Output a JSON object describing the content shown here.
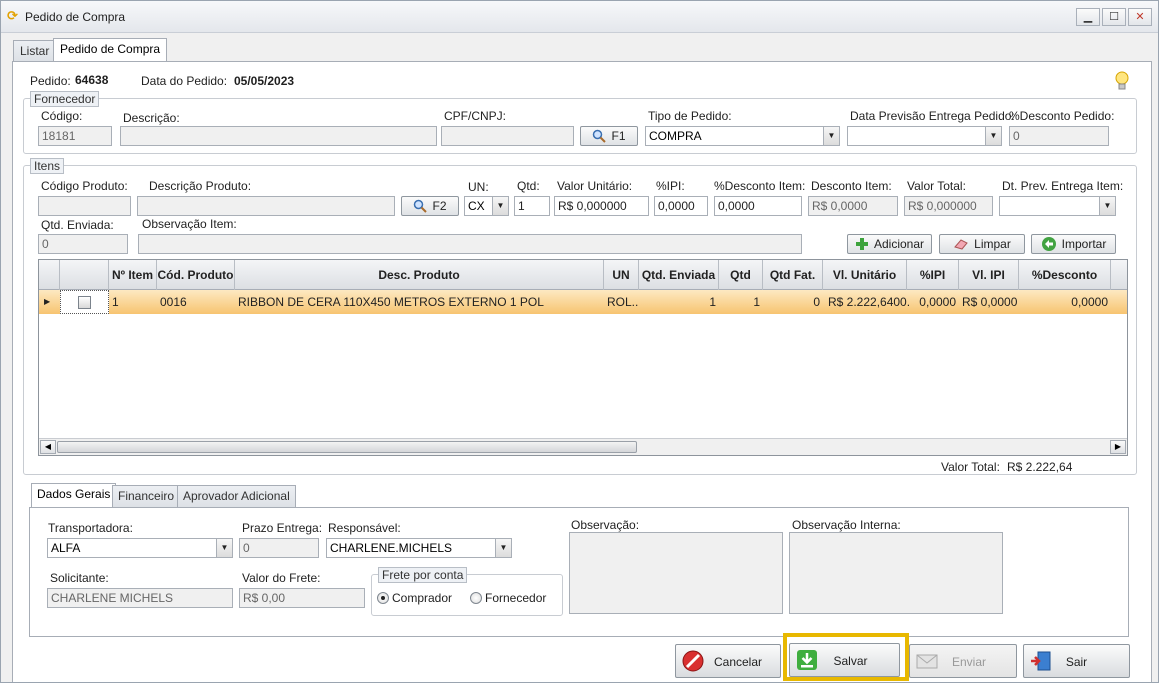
{
  "window": {
    "title": "Pedido de Compra",
    "min": "▁",
    "max": "☐",
    "close": "✕"
  },
  "tabs": [
    "Listar",
    "Pedido de Compra"
  ],
  "header": {
    "pedido_label": "Pedido:",
    "pedido_value": "64638",
    "data_label": "Data do Pedido:",
    "data_value": "05/05/2023"
  },
  "fornecedor": {
    "legend": "Fornecedor",
    "codigo_label": "Código:",
    "codigo_value": "18181",
    "descricao_label": "Descrição:",
    "cpf_label": "CPF/CNPJ:",
    "f1_label": "F1",
    "tipo_label": "Tipo de Pedido:",
    "tipo_value": "COMPRA",
    "data_prev_label": "Data Previsão Entrega Pedido:",
    "data_prev_value": "",
    "desconto_label": "%Desconto Pedido:",
    "desconto_value": "0"
  },
  "itens": {
    "legend": "Itens",
    "cod_prod_label": "Código Produto:",
    "desc_prod_label": "Descrição Produto:",
    "f2_label": "F2",
    "un_label": "UN:",
    "un_value": "CX",
    "qtd_label": "Qtd:",
    "qtd_value": "1",
    "valor_unit_label": "Valor Unitário:",
    "valor_unit_value": "R$ 0,000000",
    "ipi_label": "%IPI:",
    "ipi_value": "0,0000",
    "pdesc_label": "%Desconto Item:",
    "pdesc_value": "0,0000",
    "desc_item_label": "Desconto Item:",
    "desc_item_value": "R$ 0,0000",
    "valor_total_label": "Valor Total:",
    "valor_total_value": "R$ 0,000000",
    "dt_prev_label": "Dt. Prev. Entrega Item:",
    "qtd_env_label": "Qtd. Enviada:",
    "qtd_env_value": "0",
    "obs_label": "Observação Item:",
    "adicionar": "Adicionar",
    "limpar": "Limpar",
    "importar": "Importar"
  },
  "grid": {
    "columns": [
      "Nº Item",
      "Cód. Produto",
      "Desc. Produto",
      "UN",
      "Qtd. Enviada",
      "Qtd",
      "Qtd Fat.",
      "Vl. Unitário",
      "%IPI",
      "Vl. IPI",
      "%Desconto"
    ],
    "rows": [
      {
        "item": "1",
        "cod": "0016",
        "desc": "RIBBON DE CERA 110X450 METROS EXTERNO 1 POL",
        "un": "ROL...",
        "qtd_env": "1",
        "qtd": "1",
        "qtd_fat": "0",
        "vl_unit": "R$ 2.222,6400...",
        "ipi": "0,0000",
        "vl_ipi": "R$ 0,0000",
        "desconto": "0,0000"
      }
    ],
    "total_label": "Valor Total:",
    "total_value": "R$ 2.222,64"
  },
  "bottom_tabs": [
    "Dados Gerais",
    "Financeiro",
    "Aprovador Adicional"
  ],
  "dados": {
    "transp_label": "Transportadora:",
    "transp_value": "ALFA",
    "prazo_label": "Prazo Entrega:",
    "prazo_value": "0",
    "resp_label": "Responsável:",
    "resp_value": "CHARLENE.MICHELS",
    "obs_label": "Observação:",
    "obs_int_label": "Observação Interna:",
    "solic_label": "Solicitante:",
    "solic_value": "CHARLENE MICHELS",
    "frete_label": "Valor do Frete:",
    "frete_value": "R$ 0,00",
    "frete_conta_legend": "Frete por conta",
    "comprador": "Comprador",
    "fornecedor": "Fornecedor"
  },
  "actions": {
    "cancelar": "Cancelar",
    "salvar": "Salvar",
    "enviar": "Enviar",
    "sair": "Sair"
  },
  "colors": {
    "highlight": "#e8b800",
    "row": "#f7c470"
  }
}
